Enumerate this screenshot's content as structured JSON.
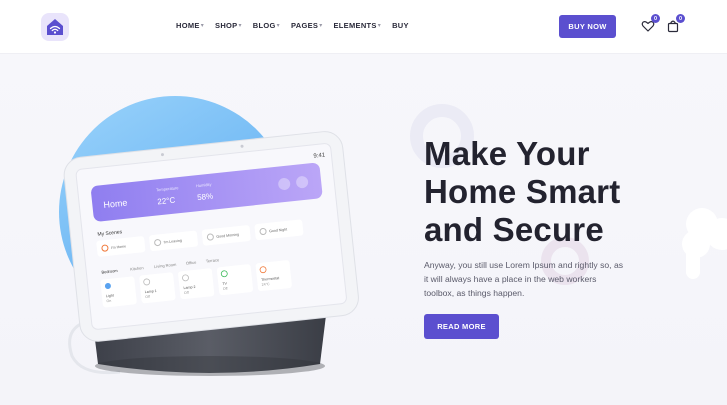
{
  "nav": {
    "items": [
      {
        "label": "HOME",
        "has_dropdown": true
      },
      {
        "label": "SHOP",
        "has_dropdown": true
      },
      {
        "label": "BLOG",
        "has_dropdown": true
      },
      {
        "label": "PAGES",
        "has_dropdown": true
      },
      {
        "label": "ELEMENTS",
        "has_dropdown": true
      },
      {
        "label": "BUY",
        "has_dropdown": false
      }
    ],
    "buy_now_label": "BUY NOW",
    "wishlist_count": "0",
    "cart_count": "0"
  },
  "hero": {
    "headline_line1": "Make Your",
    "headline_line2": "Home Smart",
    "headline_line3": "and Secure",
    "paragraph": "Anyway, you still use Lorem Ipsum and rightly so, as it will always have a place in the web workers toolbox, as things happen.",
    "cta_label": "READ MORE"
  },
  "device_screen": {
    "time": "9:41",
    "card_title": "Home",
    "temp_label": "Temperature",
    "temp_value": "22°C",
    "humidity_label": "Humidity",
    "humidity_value": "58%",
    "scenes_title": "My Scenes",
    "scenes": [
      "I'm Home",
      "I'm Leaving",
      "Good Morning",
      "Good Night"
    ],
    "rooms": [
      "Bedroom",
      "Kitchen",
      "Living Room",
      "Office",
      "Terrace"
    ],
    "devices": [
      {
        "name": "Light",
        "state": "On"
      },
      {
        "name": "Lamp 1",
        "state": "Off"
      },
      {
        "name": "Lamp 2",
        "state": "Off"
      },
      {
        "name": "TV",
        "state": "Off"
      },
      {
        "name": "Thermostat",
        "state": "24°C"
      }
    ]
  },
  "colors": {
    "accent": "#5b4fcf",
    "heading": "#23232f",
    "blob_blue": "#7ec3f7",
    "blob_purple": "#b286f0"
  },
  "icons": {
    "logo": "home-wifi-icon",
    "wishlist": "heart-icon",
    "cart": "shopping-bag-icon"
  }
}
